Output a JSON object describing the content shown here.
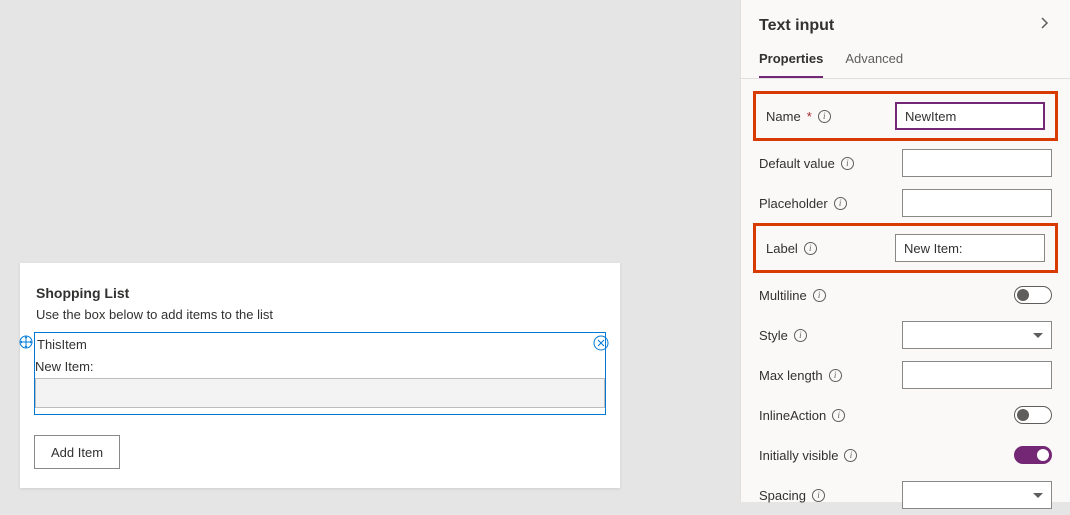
{
  "canvas": {
    "card_title": "Shopping List",
    "card_subtitle": "Use the box below to add items to the list",
    "selection_label": "ThisItem",
    "field_label": "New Item:",
    "add_button_label": "Add Item"
  },
  "panel": {
    "title": "Text input",
    "tabs": {
      "properties": "Properties",
      "advanced": "Advanced"
    },
    "props": {
      "name": {
        "label": "Name",
        "value": "NewItem"
      },
      "default_value": {
        "label": "Default value",
        "value": ""
      },
      "placeholder": {
        "label": "Placeholder",
        "value": ""
      },
      "label": {
        "label": "Label",
        "value": "New Item:"
      },
      "multiline": {
        "label": "Multiline",
        "value": false
      },
      "style": {
        "label": "Style",
        "value": ""
      },
      "max_length": {
        "label": "Max length",
        "value": ""
      },
      "inline_action": {
        "label": "InlineAction",
        "value": false
      },
      "initially_visible": {
        "label": "Initially visible",
        "value": true
      },
      "spacing": {
        "label": "Spacing",
        "value": ""
      }
    }
  }
}
